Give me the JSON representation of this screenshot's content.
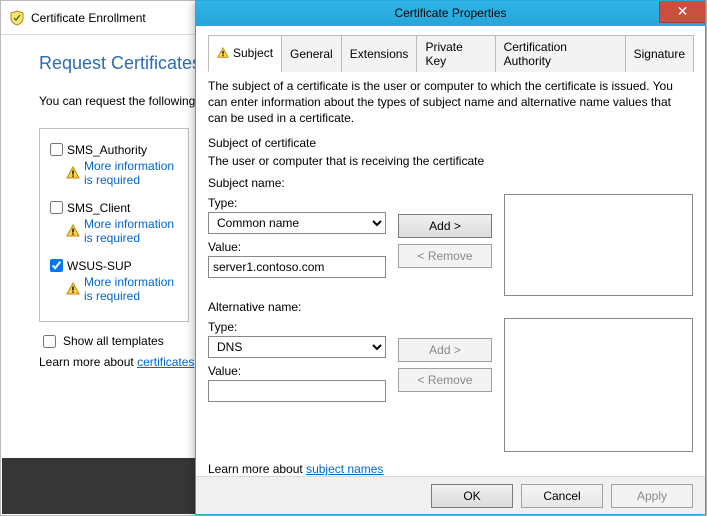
{
  "enroll": {
    "title": "Certificate Enrollment",
    "heading": "Request Certificates",
    "intro": "You can request the following types of certificates. Select the certificates you want to request, and then click Enroll.",
    "templates": [
      {
        "name": "SMS_Authority",
        "checked": false,
        "more": "More information is required"
      },
      {
        "name": "SMS_Client",
        "checked": false,
        "more": "More information is required"
      },
      {
        "name": "WSUS-SUP",
        "checked": true,
        "more": "More information is required"
      }
    ],
    "show_all": "Show all templates",
    "learn_prefix": "Learn more about ",
    "learn_link": "certificates"
  },
  "dialog": {
    "title": "Certificate Properties",
    "tabs": [
      "Subject",
      "General",
      "Extensions",
      "Private Key",
      "Certification Authority",
      "Signature"
    ],
    "desc": "The subject of a certificate is the user or computer to which the certificate is issued. You can enter information about the types of subject name and alternative name values that can be used in a certificate.",
    "subj_of_cert": "Subject of certificate",
    "subj_receiver": "The user or computer that is receiving the certificate",
    "subject_name_h": "Subject name:",
    "type_label": "Type:",
    "value_label": "Value:",
    "subject_type": "Common name",
    "subject_value": "server1.contoso.com",
    "alt_name_h": "Alternative name:",
    "alt_type": "DNS",
    "alt_value": "",
    "add_label": "Add >",
    "remove_label": "< Remove",
    "learn_prefix": "Learn more about ",
    "learn_link": "subject names",
    "ok": "OK",
    "cancel": "Cancel",
    "apply": "Apply"
  }
}
